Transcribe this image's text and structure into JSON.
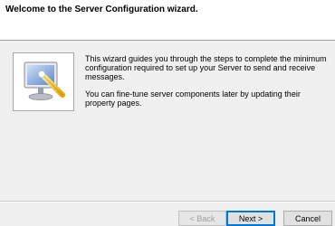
{
  "header": {
    "title": "Welcome to the Server Configuration wizard."
  },
  "content": {
    "paragraph1": "This wizard guides you through the steps to complete the minimum configuration required to set up your Server to send and receive messages.",
    "paragraph2": "You can fine-tune server components later by updating their property pages.",
    "illustration_icon": "server-wizard-icon"
  },
  "buttons": {
    "back": "< Back",
    "next": "Next >",
    "cancel": "Cancel"
  },
  "colors": {
    "header_bg": "#ffffff",
    "dialog_bg": "#f0f0f0",
    "default_button_border": "#0078d7"
  }
}
